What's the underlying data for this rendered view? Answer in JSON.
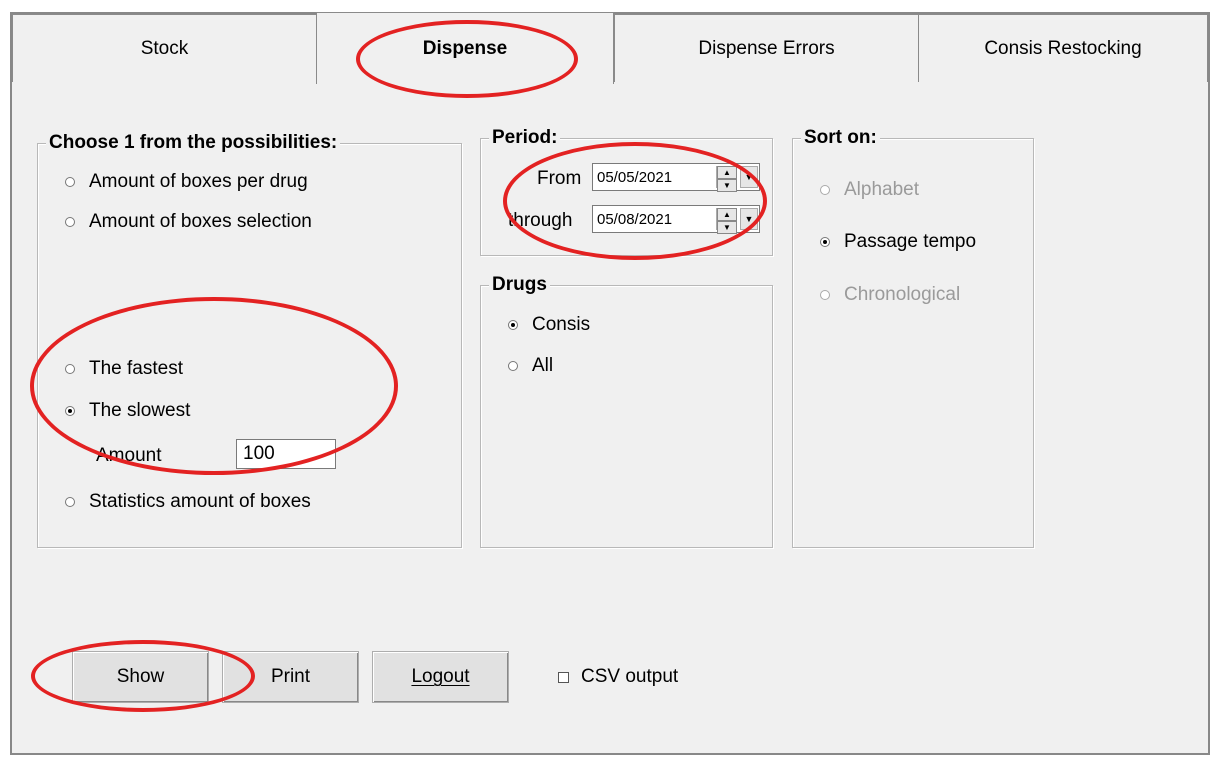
{
  "tabs": [
    {
      "label": "Stock"
    },
    {
      "label": "Dispense"
    },
    {
      "label": "Dispense Errors"
    },
    {
      "label": "Consis Restocking"
    }
  ],
  "choose_group": {
    "legend": "Choose 1 from the possibilities:",
    "options": [
      {
        "label": "Amount of boxes per drug",
        "checked": false
      },
      {
        "label": "Amount of boxes selection",
        "checked": false
      },
      {
        "label": "The fastest",
        "checked": false
      },
      {
        "label": "The slowest",
        "checked": true
      },
      {
        "label": "Statistics amount of boxes",
        "checked": false
      }
    ],
    "amount_label": "Amount",
    "amount_value": "100"
  },
  "period_group": {
    "legend": "Period:",
    "from_label": "From",
    "from_value": "05/05/2021",
    "through_label": "through",
    "through_value": "05/08/2021"
  },
  "drugs_group": {
    "legend": "Drugs",
    "options": [
      {
        "label": "Consis",
        "checked": true
      },
      {
        "label": "All",
        "checked": false
      }
    ]
  },
  "sort_group": {
    "legend": "Sort on:",
    "options": [
      {
        "label": "Alphabet",
        "checked": false,
        "disabled": true
      },
      {
        "label": "Passage tempo",
        "checked": true,
        "disabled": false
      },
      {
        "label": "Chronological",
        "checked": false,
        "disabled": true
      }
    ]
  },
  "buttons": {
    "show": "Show",
    "print": "Print",
    "logout": "Logout"
  },
  "csv_output": {
    "label": "CSV output",
    "checked": false
  },
  "colors": {
    "annotation": "#e32222",
    "window_bg": "#f0f0f0"
  }
}
